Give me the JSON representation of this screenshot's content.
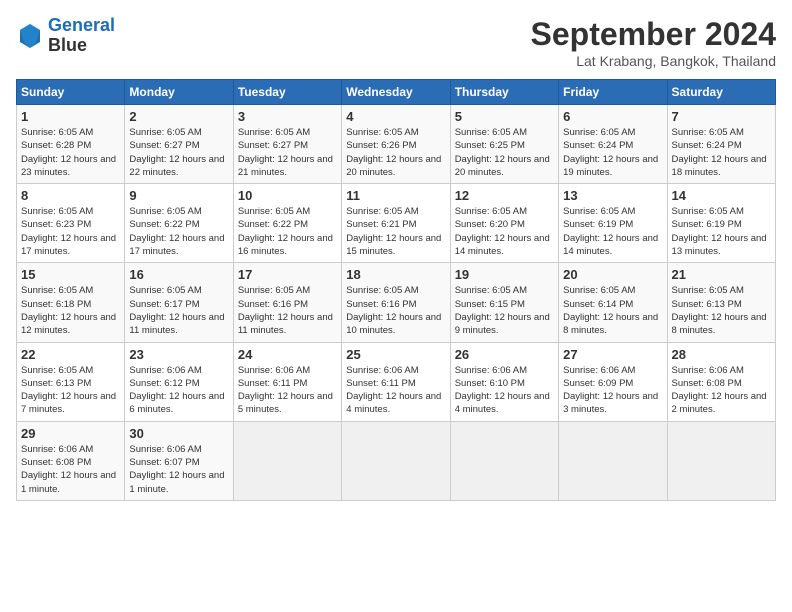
{
  "logo": {
    "line1": "General",
    "line2": "Blue"
  },
  "title": "September 2024",
  "subtitle": "Lat Krabang, Bangkok, Thailand",
  "weekdays": [
    "Sunday",
    "Monday",
    "Tuesday",
    "Wednesday",
    "Thursday",
    "Friday",
    "Saturday"
  ],
  "weeks": [
    [
      {
        "day": "1",
        "sunrise": "6:05 AM",
        "sunset": "6:28 PM",
        "daylight": "12 hours and 23 minutes."
      },
      {
        "day": "2",
        "sunrise": "6:05 AM",
        "sunset": "6:27 PM",
        "daylight": "12 hours and 22 minutes."
      },
      {
        "day": "3",
        "sunrise": "6:05 AM",
        "sunset": "6:27 PM",
        "daylight": "12 hours and 21 minutes."
      },
      {
        "day": "4",
        "sunrise": "6:05 AM",
        "sunset": "6:26 PM",
        "daylight": "12 hours and 20 minutes."
      },
      {
        "day": "5",
        "sunrise": "6:05 AM",
        "sunset": "6:25 PM",
        "daylight": "12 hours and 20 minutes."
      },
      {
        "day": "6",
        "sunrise": "6:05 AM",
        "sunset": "6:24 PM",
        "daylight": "12 hours and 19 minutes."
      },
      {
        "day": "7",
        "sunrise": "6:05 AM",
        "sunset": "6:24 PM",
        "daylight": "12 hours and 18 minutes."
      }
    ],
    [
      {
        "day": "8",
        "sunrise": "6:05 AM",
        "sunset": "6:23 PM",
        "daylight": "12 hours and 17 minutes."
      },
      {
        "day": "9",
        "sunrise": "6:05 AM",
        "sunset": "6:22 PM",
        "daylight": "12 hours and 17 minutes."
      },
      {
        "day": "10",
        "sunrise": "6:05 AM",
        "sunset": "6:22 PM",
        "daylight": "12 hours and 16 minutes."
      },
      {
        "day": "11",
        "sunrise": "6:05 AM",
        "sunset": "6:21 PM",
        "daylight": "12 hours and 15 minutes."
      },
      {
        "day": "12",
        "sunrise": "6:05 AM",
        "sunset": "6:20 PM",
        "daylight": "12 hours and 14 minutes."
      },
      {
        "day": "13",
        "sunrise": "6:05 AM",
        "sunset": "6:19 PM",
        "daylight": "12 hours and 14 minutes."
      },
      {
        "day": "14",
        "sunrise": "6:05 AM",
        "sunset": "6:19 PM",
        "daylight": "12 hours and 13 minutes."
      }
    ],
    [
      {
        "day": "15",
        "sunrise": "6:05 AM",
        "sunset": "6:18 PM",
        "daylight": "12 hours and 12 minutes."
      },
      {
        "day": "16",
        "sunrise": "6:05 AM",
        "sunset": "6:17 PM",
        "daylight": "12 hours and 11 minutes."
      },
      {
        "day": "17",
        "sunrise": "6:05 AM",
        "sunset": "6:16 PM",
        "daylight": "12 hours and 11 minutes."
      },
      {
        "day": "18",
        "sunrise": "6:05 AM",
        "sunset": "6:16 PM",
        "daylight": "12 hours and 10 minutes."
      },
      {
        "day": "19",
        "sunrise": "6:05 AM",
        "sunset": "6:15 PM",
        "daylight": "12 hours and 9 minutes."
      },
      {
        "day": "20",
        "sunrise": "6:05 AM",
        "sunset": "6:14 PM",
        "daylight": "12 hours and 8 minutes."
      },
      {
        "day": "21",
        "sunrise": "6:05 AM",
        "sunset": "6:13 PM",
        "daylight": "12 hours and 8 minutes."
      }
    ],
    [
      {
        "day": "22",
        "sunrise": "6:05 AM",
        "sunset": "6:13 PM",
        "daylight": "12 hours and 7 minutes."
      },
      {
        "day": "23",
        "sunrise": "6:06 AM",
        "sunset": "6:12 PM",
        "daylight": "12 hours and 6 minutes."
      },
      {
        "day": "24",
        "sunrise": "6:06 AM",
        "sunset": "6:11 PM",
        "daylight": "12 hours and 5 minutes."
      },
      {
        "day": "25",
        "sunrise": "6:06 AM",
        "sunset": "6:11 PM",
        "daylight": "12 hours and 4 minutes."
      },
      {
        "day": "26",
        "sunrise": "6:06 AM",
        "sunset": "6:10 PM",
        "daylight": "12 hours and 4 minutes."
      },
      {
        "day": "27",
        "sunrise": "6:06 AM",
        "sunset": "6:09 PM",
        "daylight": "12 hours and 3 minutes."
      },
      {
        "day": "28",
        "sunrise": "6:06 AM",
        "sunset": "6:08 PM",
        "daylight": "12 hours and 2 minutes."
      }
    ],
    [
      {
        "day": "29",
        "sunrise": "6:06 AM",
        "sunset": "6:08 PM",
        "daylight": "12 hours and 1 minute."
      },
      {
        "day": "30",
        "sunrise": "6:06 AM",
        "sunset": "6:07 PM",
        "daylight": "12 hours and 1 minute."
      },
      null,
      null,
      null,
      null,
      null
    ]
  ]
}
